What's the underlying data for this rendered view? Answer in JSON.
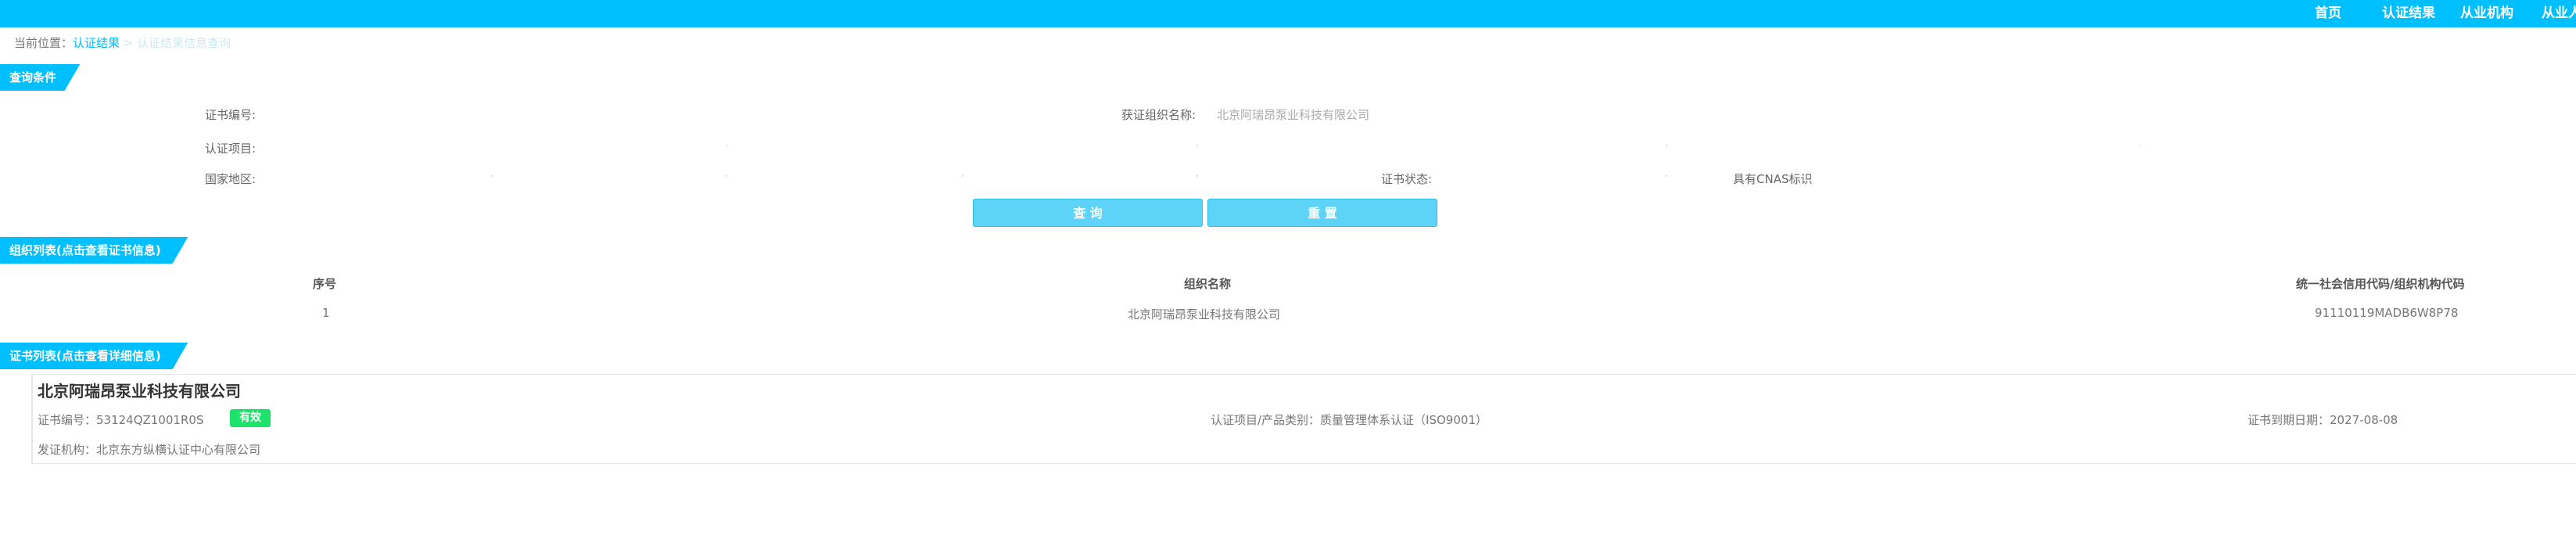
{
  "nav": {
    "items": [
      "首页",
      "认证结果",
      "从业机构",
      "从业人"
    ]
  },
  "breadcrumb": {
    "prefix": "当前位置：",
    "link": "认证结果",
    "sep": " > ",
    "current": "认证结果信息查询"
  },
  "sections": {
    "query": "查询条件",
    "org_list": "组织列表(点击查看证书信息)",
    "cert_list": "证书列表(点击查看详细信息)"
  },
  "query": {
    "cert_no_label": "证书编号:",
    "org_name_label": "获证组织名称:",
    "org_name_value": "北京阿瑞昂泵业科技有限公司",
    "project_label": "认证项目:",
    "region_label": "国家地区:",
    "status_label": "证书状态:",
    "cnas_label": "具有CNAS标识",
    "search_button": "查 询",
    "reset_button": "重 置"
  },
  "org_table": {
    "headers": [
      "序号",
      "组织名称",
      "统一社会信用代码/组织机构代码"
    ],
    "rows": [
      [
        "1",
        "北京阿瑞昂泵业科技有限公司",
        "91110119MADB6W8P78"
      ]
    ]
  },
  "cert": {
    "org_name": "北京阿瑞昂泵业科技有限公司",
    "cert_no": "证书编号：53124QZ1001R0S",
    "status": "有效",
    "project": "认证项目/产品类别：质量管理体系认证（ISO9001）",
    "expiry": "证书到期日期：2027-08-08",
    "issuer": "发证机构：北京东方纵横认证中心有限公司"
  },
  "colors": {
    "brand": "#00bfff",
    "button": "#5cd3f7",
    "badge": "#1ee36b"
  }
}
